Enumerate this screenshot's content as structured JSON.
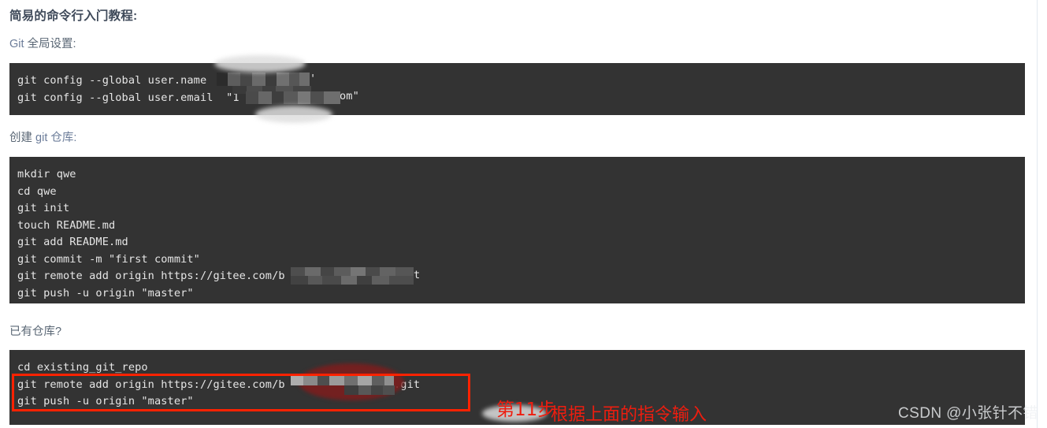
{
  "page": {
    "heading": "简易的命令行入门教程:",
    "background_color": "#ffffff",
    "code_background_color": "#333333",
    "code_text_color": "#e6e6e6",
    "heading_color": "#3f4a5a",
    "label_color": "#5a6775",
    "annotation_color": "#ee1d0f",
    "redaction_note": "mosaic / blur redaction over private account and repository names"
  },
  "sections": [
    {
      "label_prefix": "Git",
      "label_rest": " 全局设置:",
      "label_full": "Git 全局设置:",
      "code_lines": [
        "git config --global user.name",
        "git config --global user.email  \"1"
      ],
      "code_line_tails": [
        "'",
        "om\""
      ]
    },
    {
      "label_prefix": "创建 ",
      "label_rest": "git 仓库:",
      "label_full": "创建 git 仓库:",
      "code_lines": [
        "mkdir qwe",
        "cd qwe",
        "git init",
        "touch README.md",
        "git add README.md",
        "git commit -m \"first commit\"",
        "git remote add origin https://gitee.com/b",
        "git push -u origin \"master\""
      ],
      "code_line_tails": [
        "t"
      ]
    },
    {
      "label_prefix": "",
      "label_rest": "已有仓库?",
      "label_full": "已有仓库?",
      "code_lines": [
        "cd existing_git_repo",
        "git remote add origin https://gitee.com/b",
        "git push -u origin \"master\""
      ],
      "code_line_tails": [
        ".git"
      ]
    }
  ],
  "annotations": {
    "step_label": "第11步",
    "description": "根据上面的指令输入",
    "box_color": "#ff2200"
  },
  "watermark": {
    "text": "CSDN @小张针不错"
  }
}
